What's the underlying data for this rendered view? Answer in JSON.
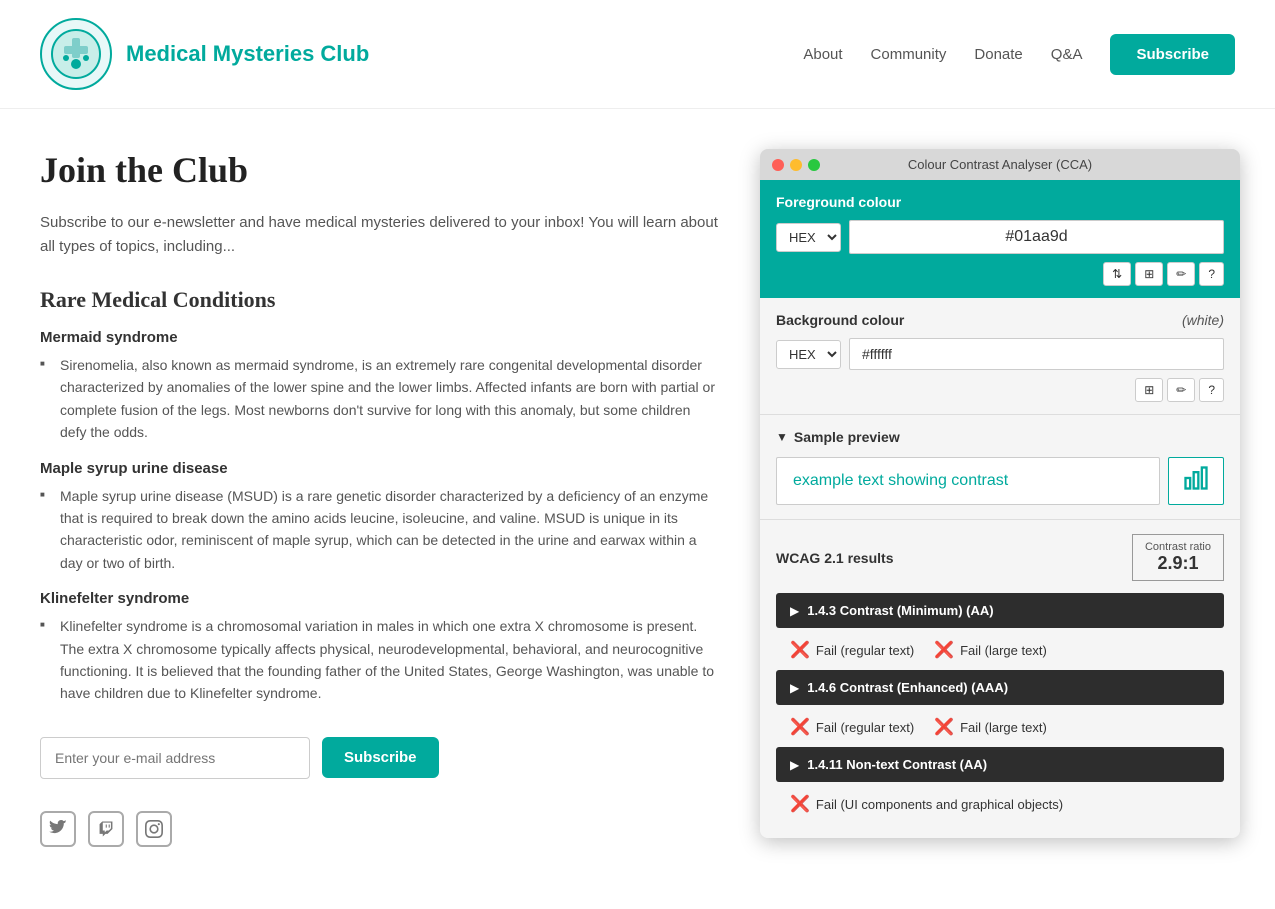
{
  "header": {
    "site_title": "Medical Mysteries Club",
    "nav": {
      "about": "About",
      "community": "Community",
      "donate": "Donate",
      "qa": "Q&A",
      "subscribe": "Subscribe"
    }
  },
  "main": {
    "page_heading": "Join the Club",
    "intro_text": "Subscribe to our e-newsletter and have medical mysteries delivered to your inbox! You will learn about all types of topics, including...",
    "section_heading": "Rare Medical Conditions",
    "conditions": [
      {
        "name": "Mermaid syndrome",
        "description": "Sirenomelia, also known as mermaid syndrome, is an extremely rare congenital developmental disorder characterized by anomalies of the lower spine and the lower limbs. Affected infants are born with partial or complete fusion of the legs. Most newborns don't survive for long with this anomaly, but some children defy the odds."
      },
      {
        "name": "Maple syrup urine disease",
        "description": "Maple syrup urine disease (MSUD) is a rare genetic disorder characterized by a deficiency of an enzyme that is required to break down the amino acids leucine, isoleucine, and valine. MSUD is unique in its characteristic odor, reminiscent of maple syrup, which can be detected in the urine and earwax within a day or two of birth."
      },
      {
        "name": "Klinefelter syndrome",
        "description": "Klinefelter syndrome is a chromosomal variation in males in which one extra X chromosome is present. The extra X chromosome typically affects physical, neurodevelopmental, behavioral, and neurocognitive functioning. It is believed that the founding father of the United States, George Washington, was unable to have children due to Klinefelter syndrome."
      }
    ],
    "email_placeholder": "Enter your e-mail address",
    "subscribe_btn": "Subscribe"
  },
  "cca": {
    "title": "Colour Contrast Analyser (CCA)",
    "foreground_label": "Foreground colour",
    "fg_format": "HEX",
    "fg_value": "#01aa9d",
    "bg_label": "Background colour",
    "bg_white": "(white)",
    "bg_format": "HEX",
    "bg_value": "#ffffff",
    "preview_label": "Sample preview",
    "preview_text": "example text showing contrast",
    "wcag_label": "WCAG 2.1 results",
    "contrast_ratio_label": "Contrast ratio",
    "contrast_ratio_value": "2.9:1",
    "criteria": [
      {
        "id": "1.4.3",
        "name": "1.4.3 Contrast (Minimum) (AA)",
        "results": [
          {
            "type": "fail",
            "label": "Fail (regular text)"
          },
          {
            "type": "fail",
            "label": "Fail (large text)"
          }
        ]
      },
      {
        "id": "1.4.6",
        "name": "1.4.6 Contrast (Enhanced) (AAA)",
        "results": [
          {
            "type": "fail",
            "label": "Fail (regular text)"
          },
          {
            "type": "fail",
            "label": "Fail (large text)"
          }
        ]
      },
      {
        "id": "1.4.11",
        "name": "1.4.11 Non-text Contrast (AA)",
        "results": [
          {
            "type": "fail",
            "label": "Fail (UI components and graphical objects)"
          }
        ]
      }
    ]
  }
}
